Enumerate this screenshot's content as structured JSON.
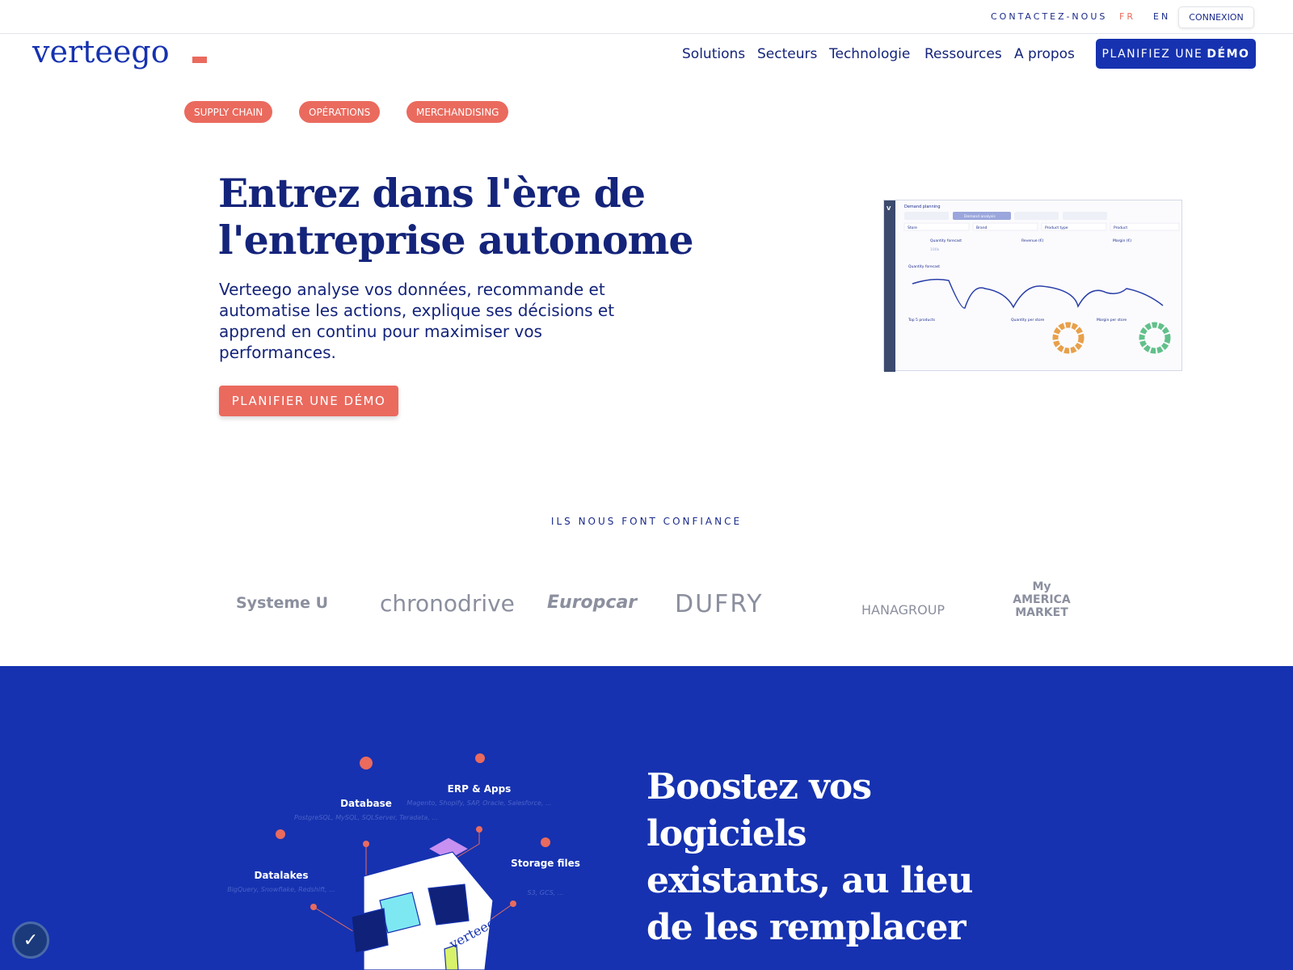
{
  "topbar": {
    "contact": "CONTACTEZ-NOUS",
    "lang_fr": "FR",
    "lang_en": "EN",
    "login": "CONNEXION"
  },
  "logo": "verteego",
  "nav": {
    "items": [
      "Solutions",
      "Secteurs",
      "Technologie",
      "Ressources",
      "A propos"
    ],
    "demo_prefix": "PLANIFIEZ UNE",
    "demo_bold": "DÉMO"
  },
  "tags": [
    "SUPPLY CHAIN",
    "OPÉRATIONS",
    "MERCHANDISING"
  ],
  "hero": {
    "title_line1": "Entrez dans l'ère de",
    "title_line2": "l'entreprise autonome",
    "lead": "Verteego analyse vos données, recommande et automatise les actions, explique ses décisions et apprend en continu pour maximiser vos performances.",
    "cta": "PLANIFIER UNE DÉMO"
  },
  "dashboard": {
    "title": "Demand planning",
    "tab": "Demand analysis",
    "filters": [
      "Store",
      "Brand",
      "Product type",
      "Product"
    ],
    "kpis": [
      "Quantity forecast",
      "Revenue (€)",
      "Margin (€)"
    ],
    "kpi_value": "100k",
    "chart_title": "Quantity forecast",
    "top5": "Top 5 products",
    "qty_store": "Quantity per store",
    "margin_store": "Margin per store"
  },
  "trust": {
    "title": "ILS NOUS FONT CONFIANCE",
    "clients": [
      "Systeme U",
      "chronodrive",
      "Europcar",
      "DUFRY",
      "HANAGROUP",
      "My AMERICA MARKET"
    ]
  },
  "integrations": {
    "logo": "verteego",
    "items": [
      {
        "name": "Database",
        "desc": "PostgreSQL, MySQL, SQLServer, Teradata, ..."
      },
      {
        "name": "ERP & Apps",
        "desc": "Magento, Shopify, SAP, Oracle, Salesforce, ..."
      },
      {
        "name": "Datalakes",
        "desc": "BigQuery, Snowflake, Redshift, ..."
      },
      {
        "name": "Storage files",
        "desc": "S3, GCS, ..."
      }
    ]
  },
  "section2": {
    "title_lines": [
      "Boostez vos",
      "logiciels",
      "existants, au lieu",
      "de les remplacer"
    ]
  },
  "colors": {
    "brand_blue": "#1632b0",
    "coral": "#ea6a5e",
    "navy": "#14247a"
  }
}
